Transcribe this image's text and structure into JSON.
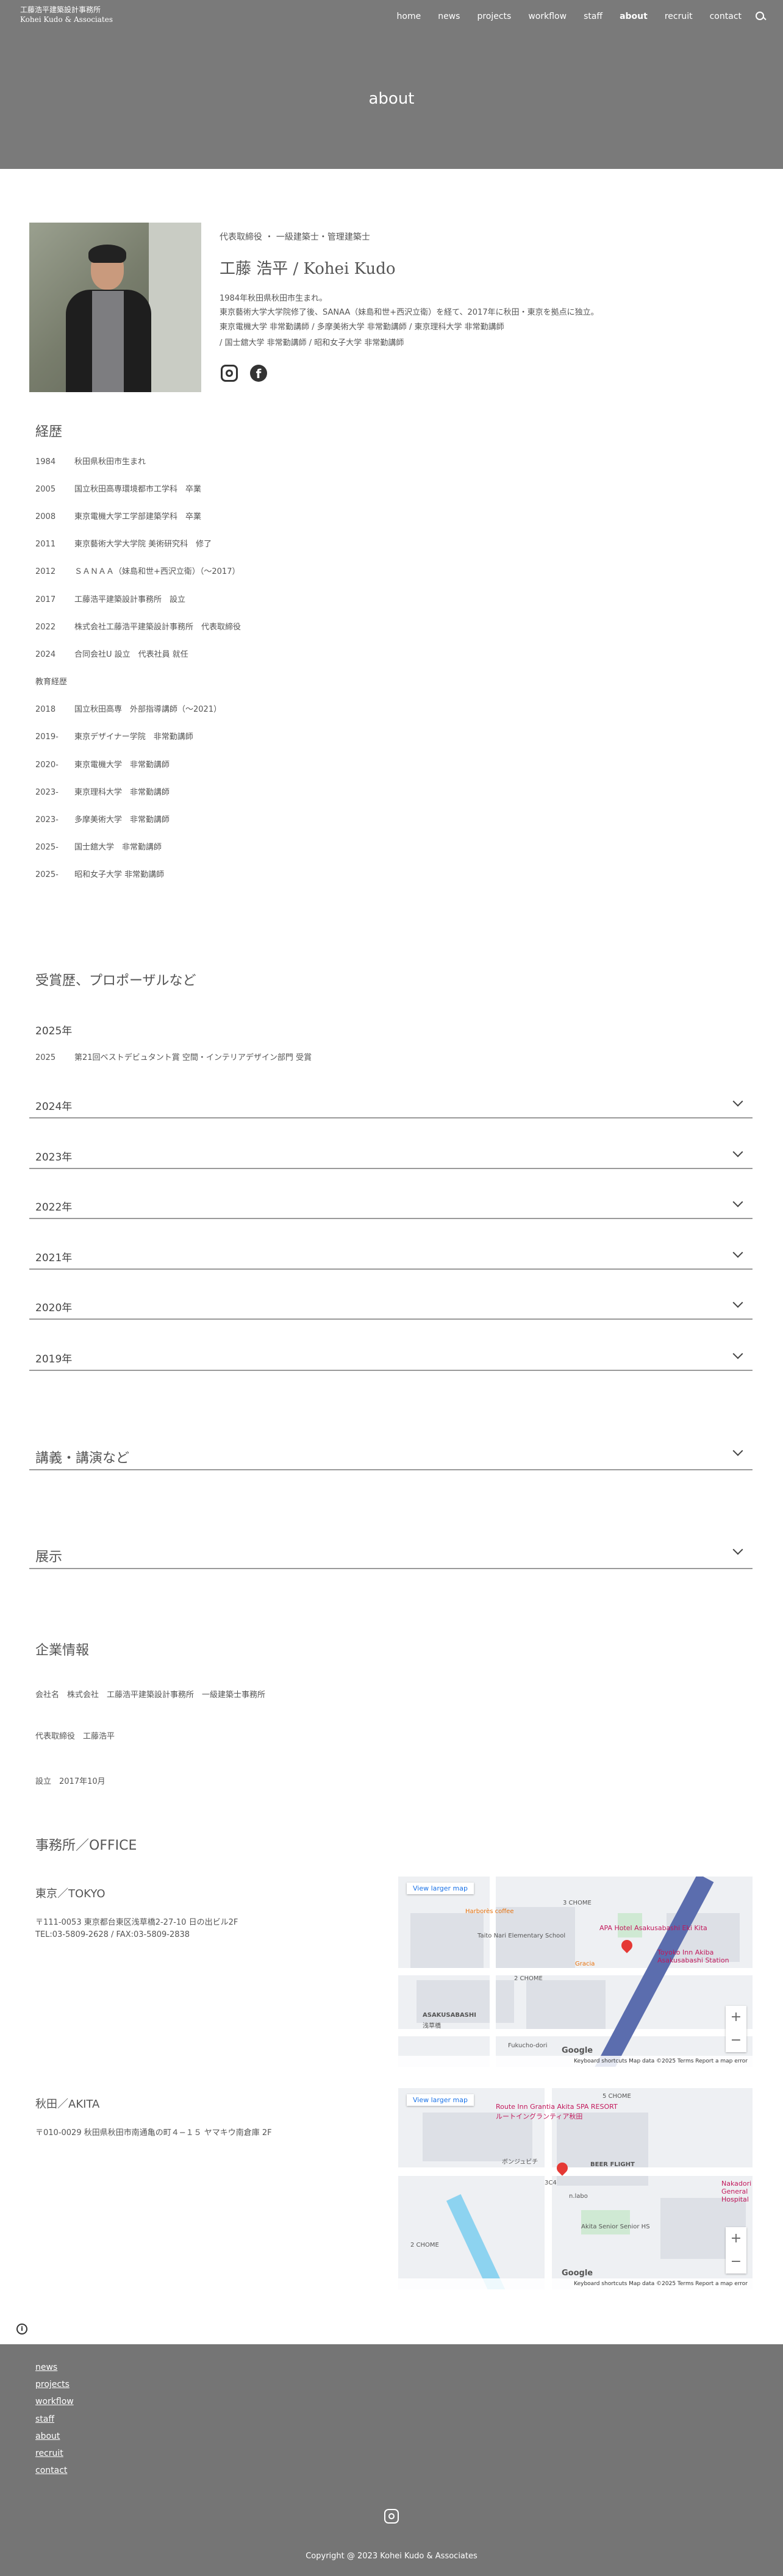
{
  "brand": {
    "name_jp": "工藤浩平建築設計事務所",
    "name_en": "Kohei Kudo & Associates"
  },
  "nav": [
    {
      "label": "home"
    },
    {
      "label": "news"
    },
    {
      "label": "projects"
    },
    {
      "label": "workflow"
    },
    {
      "label": "staff"
    },
    {
      "label": "about",
      "active": true
    },
    {
      "label": "recruit"
    },
    {
      "label": "contact"
    }
  ],
  "hero": {
    "title": "about"
  },
  "profile": {
    "role": "代表取締役 ・ 一級建築士・管理建築士",
    "name": "工藤 浩平 / Kohei Kudo",
    "bio": [
      "1984年秋田県秋田市生まれ。",
      "東京藝術大学大学院修了後、SANAA（妹島和世+西沢立衛）を経て、2017年に秋田・東京を拠点に独立。",
      "東京電機大学 非常勤講師 / 多摩美術大学 非常勤講師 / 東京理科大学 非常勤講師",
      "/ 国士舘大学 非常勤講師 / 昭和女子大学 非常勤講師"
    ]
  },
  "career": {
    "title": "経歴",
    "items": [
      {
        "year": "1984",
        "text": "秋田県秋田市生まれ"
      },
      {
        "year": "2005",
        "text": "国立秋田高専環境都市工学科　卒業"
      },
      {
        "year": "2008",
        "text": "東京電機大学工学部建築学科　卒業"
      },
      {
        "year": "2011",
        "text": "東京藝術大学大学院 美術研究科　修了"
      },
      {
        "year": "2012",
        "text": "ＳＡＮＡＡ（妹島和世+西沢立衛）（〜2017）"
      },
      {
        "year": "2017",
        "text": "工藤浩平建築設計事務所　設立"
      },
      {
        "year": "2022",
        "text": "株式会社工藤浩平建築設計事務所　代表取締役"
      },
      {
        "year": "2024",
        "text": "合同会社U  設立　代表社員  就任"
      }
    ],
    "edu_title": "教育経歴",
    "edu": [
      {
        "year": "2018",
        "text": "国立秋田高専　外部指導講師（〜2021）"
      },
      {
        "year": "2019-",
        "text": "東京デザイナー学院　非常勤講師"
      },
      {
        "year": "2020-",
        "text": "東京電機大学　非常勤講師"
      },
      {
        "year": "2023-",
        "text": "東京理科大学　非常勤講師"
      },
      {
        "year": "2023-",
        "text": "多摩美術大学　非常勤講師"
      },
      {
        "year": "2025-",
        "text": "国士舘大学　非常勤講師"
      },
      {
        "year": "2025-",
        "text": "昭和女子大学  非常勤講師"
      }
    ]
  },
  "awards": {
    "title": "受賞歴、プロポーザルなど",
    "open_year": "2025年",
    "open_item": {
      "year": "2025",
      "text": "第21回ベストデビュタント賞  空間・インテリアデザイン部門  受賞"
    },
    "years": [
      "2024年",
      "2023年",
      "2022年",
      "2021年",
      "2020年",
      "2019年"
    ]
  },
  "sections": [
    {
      "label": "講義・講演など"
    },
    {
      "label": "展示"
    }
  ],
  "company": {
    "title": "企業情報",
    "name": "会社名　株式会社　工藤浩平建築設計事務所　一級建築士事務所",
    "ceo": "代表取締役　工藤浩平",
    "founded": "設立　2017年10月"
  },
  "offices": {
    "title": "事務所／OFFICE",
    "tokyo": {
      "name": "東京／TOKYO",
      "addr": "〒111-0053 東京都台東区浅草橋2-27-10 日の出ビル2F",
      "tel": "TEL:03-5809-2628 / FAX:03-5809-2838"
    },
    "akita": {
      "name": "秋田／AKITA",
      "addr": "〒010-0029 秋田県秋田市南通亀の町４−１５ ヤマキウ南倉庫 2F"
    }
  },
  "map_tokyo": {
    "view_larger": "View larger map",
    "labels": [
      "Harborès coffee",
      "3 CHOME",
      "Taito Nari Elementary School",
      "APA Hotel Asakusabashi Eki Kita",
      "2 CHOME",
      "Gracia",
      "Toyoko Inn Akiba Asakusabashi Station",
      "ASAKUSABASHI",
      "浅草橋",
      "Fukucho-dori"
    ],
    "footer": "Keyboard shortcuts    Map data ©2025    Terms    Report a map error",
    "logo": "Google"
  },
  "map_akita": {
    "view_larger": "View larger map",
    "labels": [
      "Route Inn Grantia Akita SPA RESORT",
      "ルートイングランティア秋田",
      "5 CHOME",
      "BEER FLIGHT",
      "ボンジュビチ",
      "3C4",
      "n.labo",
      "Nakadori General Hospital",
      "Akita Senior Senior HS",
      "2 CHOME"
    ],
    "footer": "Keyboard shortcuts    Map data ©2025    Terms    Report a map error",
    "logo": "Google"
  },
  "footer": {
    "links": [
      "news",
      "projects",
      "workflow",
      "staff",
      "about",
      "recruit",
      "contact"
    ],
    "copyright": "Copyright @ 2023  Kohei Kudo & Associates"
  }
}
